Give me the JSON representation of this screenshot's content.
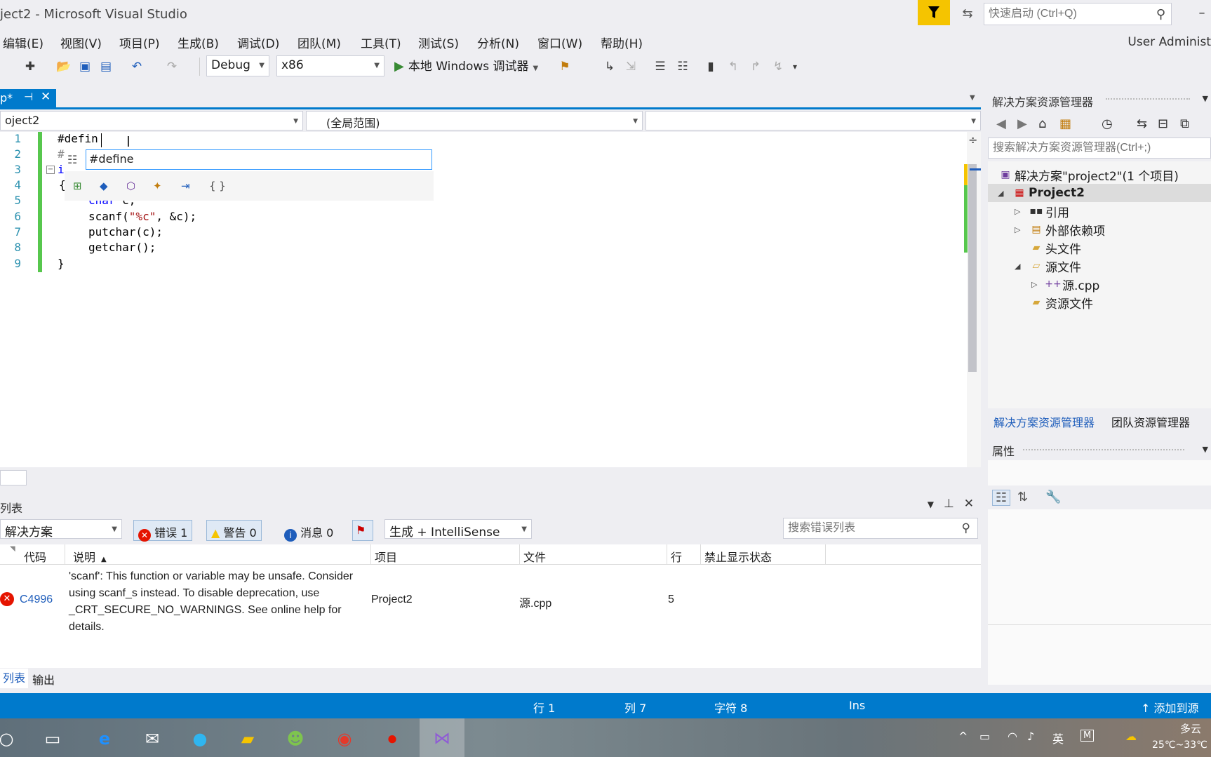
{
  "window": {
    "title": "ject2 - Microsoft Visual Studio",
    "quick_launch_placeholder": "快速启动 (Ctrl+Q)",
    "user": "User Administ"
  },
  "menu": [
    "编辑(E)",
    "视图(V)",
    "项目(P)",
    "生成(B)",
    "调试(D)",
    "团队(M)",
    "工具(T)",
    "测试(S)",
    "分析(N)",
    "窗口(W)",
    "帮助(H)"
  ],
  "toolbar": {
    "config": "Debug",
    "platform": "x86",
    "run_label": "本地 Windows 调试器"
  },
  "editor": {
    "tab_label": "p*",
    "nav_project": "oject2",
    "nav_scope": "(全局范围)",
    "nav_member": "",
    "lines": [
      "1",
      "2",
      "3",
      "4",
      "5",
      "6",
      "7",
      "8",
      "9"
    ],
    "code": {
      "l1": "#defin",
      "l2": "#",
      "l3": "i",
      "l4": "{",
      "l5_kw": "char",
      "l5_rest": " c;",
      "l6_a": "scanf(",
      "l6_str": "\"%c\"",
      "l6_b": ", &c);",
      "l7": "putchar(c);",
      "l8": "getchar();",
      "l9": "}"
    },
    "intellisense_item": "#define"
  },
  "error_list": {
    "title": "列表",
    "scope": "解决方案",
    "errors_label": "错误 1",
    "warnings_label": "警告 0",
    "messages_label": "消息 0",
    "source": "生成 + IntelliSense",
    "search_placeholder": "搜索错误列表",
    "columns": {
      "code": "代码",
      "desc": "说明",
      "project": "项目",
      "file": "文件",
      "line": "行",
      "suppress": "禁止显示状态"
    },
    "rows": [
      {
        "code": "C4996",
        "desc": "'scanf': This function or variable may be unsafe. Consider using scanf_s instead. To disable deprecation, use _CRT_SECURE_NO_WARNINGS. See online help for details.",
        "project": "Project2",
        "file": "源.cpp",
        "line": "5",
        "suppress": ""
      }
    ],
    "bottom_tabs": [
      "列表",
      "输出"
    ]
  },
  "solution_explorer": {
    "title": "解决方案资源管理器",
    "search_placeholder": "搜索解决方案资源管理器(Ctrl+;)",
    "tree": [
      {
        "label": "解决方案\"project2\"(1 个项目)",
        "icon": "solution-icon",
        "twisty": ""
      },
      {
        "label": "Project2",
        "icon": "project-icon",
        "twisty": "◢"
      },
      {
        "label": "引用",
        "icon": "references-icon",
        "twisty": "▷"
      },
      {
        "label": "外部依赖项",
        "icon": "external-deps-icon",
        "twisty": "▷"
      },
      {
        "label": "头文件",
        "icon": "folder-icon",
        "twisty": ""
      },
      {
        "label": "源文件",
        "icon": "folder-icon",
        "twisty": "◢"
      },
      {
        "label": "源.cpp",
        "icon": "cpp-file-icon",
        "twisty": "▷"
      },
      {
        "label": "资源文件",
        "icon": "folder-icon",
        "twisty": ""
      }
    ],
    "tabs": [
      "解决方案资源管理器",
      "团队资源管理器"
    ]
  },
  "properties": {
    "title": "属性"
  },
  "status_bar": {
    "line": "行 1",
    "col": "列 7",
    "char": "字符 8",
    "mode": "Ins",
    "source_control": "添加到源"
  },
  "taskbar": {
    "ime": "英",
    "weather": "多云",
    "temp": "25℃~33℃"
  },
  "colors": {
    "accent": "#007acc",
    "error": "#e51400",
    "warning": "#f5c400",
    "change_bar": "#57c74d"
  }
}
